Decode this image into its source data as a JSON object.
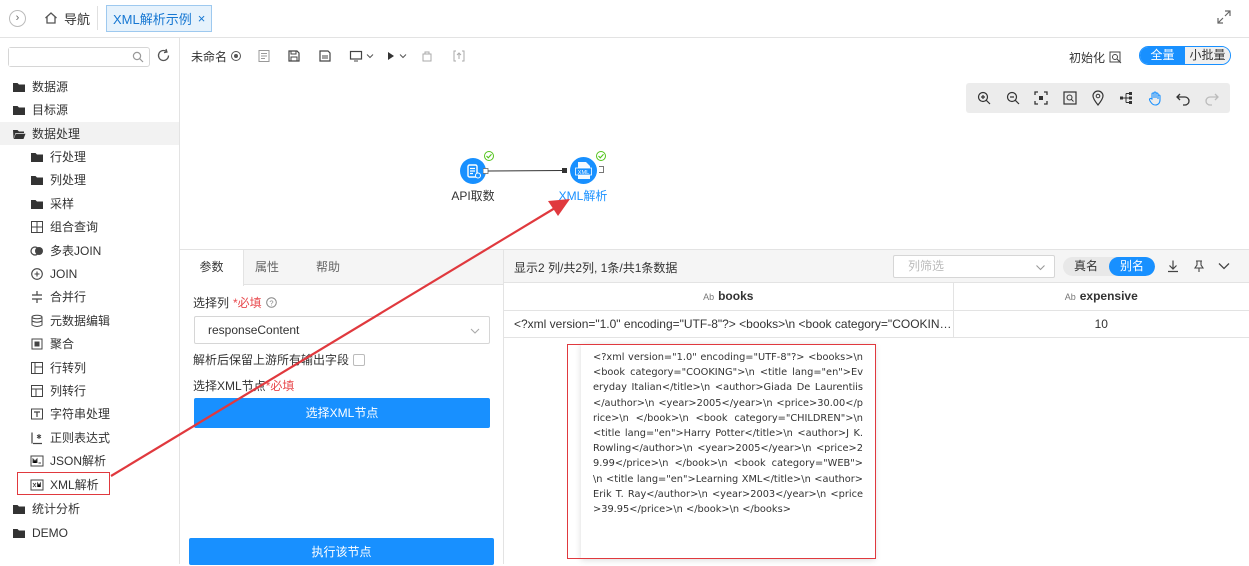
{
  "topbar": {
    "home_label": "导航",
    "active_tab_label": "XML解析示例"
  },
  "sidebar": {
    "search_placeholder": "",
    "groups": [
      {
        "label": "数据源"
      },
      {
        "label": "目标源"
      },
      {
        "label": "数据处理"
      }
    ],
    "items": [
      {
        "label": "行处理",
        "icon": "folder-icon"
      },
      {
        "label": "列处理",
        "icon": "folder-icon"
      },
      {
        "label": "采样",
        "icon": "folder-icon"
      },
      {
        "label": "组合查询",
        "icon": "combine-query-icon"
      },
      {
        "label": "多表JOIN",
        "icon": "multi-join-icon"
      },
      {
        "label": "JOIN",
        "icon": "join-icon"
      },
      {
        "label": "合并行",
        "icon": "merge-rows-icon"
      },
      {
        "label": "元数据编辑",
        "icon": "metadata-edit-icon"
      },
      {
        "label": "聚合",
        "icon": "aggregate-icon"
      },
      {
        "label": "行转列",
        "icon": "row-to-col-icon"
      },
      {
        "label": "列转行",
        "icon": "col-to-row-icon"
      },
      {
        "label": "字符串处理",
        "icon": "string-icon"
      },
      {
        "label": "正则表达式",
        "icon": "regex-icon"
      },
      {
        "label": "JSON解析",
        "icon": "json-icon"
      },
      {
        "label": "XML解析",
        "icon": "xml-icon"
      }
    ],
    "bottom_groups": [
      {
        "label": "统计分析"
      },
      {
        "label": "DEMO"
      }
    ]
  },
  "toolbar": {
    "unnamed_label": "未命名",
    "init_label": "初始化",
    "mode_full": "全量",
    "mode_batch": "小批量"
  },
  "flow": {
    "node_api_label": "API取数",
    "node_xml_label": "XML解析",
    "node_xml_badge": "XML"
  },
  "panel": {
    "tabs": [
      "参数",
      "属性",
      "帮助"
    ],
    "select_col_label": "选择列",
    "required_mark": "*必填",
    "selected_column": "responseContent",
    "retain_label": "解析后保留上游所有输出字段",
    "xml_node_label": "选择XML节点",
    "select_xml_button": "选择XML节点",
    "execute_button": "执行该节点"
  },
  "data": {
    "summary": "显示2 列/共2列,  1条/共1条数据",
    "filter_placeholder": "列筛选",
    "name_real": "真名",
    "name_alias": "别名",
    "type_mark": "Ab",
    "columns": [
      "books",
      "expensive"
    ],
    "rows": [
      {
        "books": "<?xml version=\"1.0\" encoding=\"UTF-8\"?> <books>\\n <book category=\"COOKING\">\\n <title lang=\"en\">Everyday Italian</title>\\n",
        "expensive": "10"
      }
    ],
    "tooltip_text": "<?xml version=\"1.0\" encoding=\"UTF-8\"?> <books>\\n <book category=\"COOKING\">\\n <title lang=\"en\">Everyday Italian</title>\\n <author>Giada De Laurentiis</author>\\n <year>2005</year>\\n <price>30.00</price>\\n </book>\\n <book category=\"CHILDREN\">\\n <title lang=\"en\">Harry Potter</title>\\n <author>J K. Rowling</author>\\n <year>2005</year>\\n <price>29.99</price>\\n </book>\\n <book category=\"WEB\">\\n <title lang=\"en\">Learning XML</title>\\n <author>Erik T. Ray</author>\\n <year>2003</year>\\n <price>39.95</price>\\n </book>\\n </books>"
  },
  "colors": {
    "accent": "#1890ff",
    "annotation": "#e0393e",
    "success": "#52c41a"
  }
}
